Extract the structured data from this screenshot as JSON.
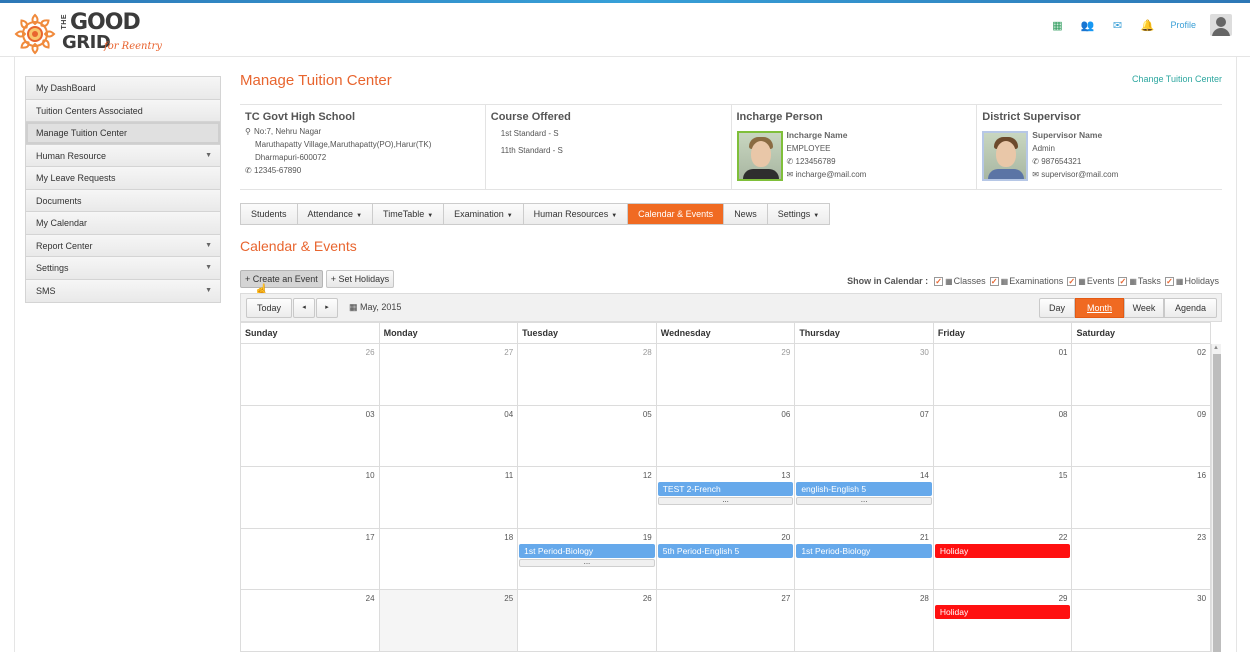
{
  "header": {
    "logo": {
      "the": "THE",
      "good": "GOOD",
      "grid": "GRID",
      "tagline": "for Reentry"
    },
    "icons": [
      "apps-grid-icon",
      "users-icon",
      "mail-icon",
      "bell-icon"
    ],
    "profile_label": "Profile"
  },
  "sidebar": {
    "items": [
      {
        "label": "My DashBoard",
        "has_submenu": false
      },
      {
        "label": "Tuition Centers Associated",
        "has_submenu": false
      },
      {
        "label": "Manage Tuition Center",
        "has_submenu": false,
        "active": true
      },
      {
        "label": "Human Resource",
        "has_submenu": true
      },
      {
        "label": "My Leave Requests",
        "has_submenu": false
      },
      {
        "label": "Documents",
        "has_submenu": false
      },
      {
        "label": "My Calendar",
        "has_submenu": false
      },
      {
        "label": "Report Center",
        "has_submenu": true
      },
      {
        "label": "Settings",
        "has_submenu": true
      },
      {
        "label": "SMS",
        "has_submenu": true
      }
    ]
  },
  "main": {
    "title": "Manage Tuition Center",
    "change_link": "Change Tuition Center",
    "center": {
      "name": "TC Govt High School",
      "address1": "No:7, Nehru Nagar",
      "address2": "Maruthapatty Village,Maruthapatty(PO),Harur(TK)",
      "address3": "Dharmapuri-600072",
      "phone": "12345-67890"
    },
    "course": {
      "title": "Course Offered",
      "items": [
        "1st Standard - S",
        "11th Standard - S"
      ]
    },
    "incharge": {
      "title": "Incharge Person",
      "name_label": "Incharge Name",
      "role": "EMPLOYEE",
      "phone": "123456789",
      "email": "incharge@mail.com"
    },
    "supervisor": {
      "title": "District Supervisor",
      "name_label": "Supervisor Name",
      "role": "Admin",
      "phone": "987654321",
      "email": "supervisor@mail.com"
    },
    "tabs": [
      {
        "label": "Students",
        "dropdown": false
      },
      {
        "label": "Attendance",
        "dropdown": true
      },
      {
        "label": "TimeTable",
        "dropdown": true
      },
      {
        "label": "Examination",
        "dropdown": true
      },
      {
        "label": "Human Resources",
        "dropdown": true
      },
      {
        "label": "Calendar & Events",
        "dropdown": false,
        "active": true
      },
      {
        "label": "News",
        "dropdown": false
      },
      {
        "label": "Settings",
        "dropdown": true
      }
    ],
    "section_title": "Calendar & Events",
    "buttons": {
      "create": "+ Create an Event",
      "holidays": "+ Set Holidays"
    },
    "show_in_calendar": {
      "label": "Show in Calendar :",
      "options": [
        "Classes",
        "Examinations",
        "Events",
        "Tasks",
        "Holidays"
      ]
    }
  },
  "calendar": {
    "today": "Today",
    "prev": "◂",
    "next": "▸",
    "current": "May, 2015",
    "views": [
      "Day",
      "Month",
      "Week",
      "Agenda"
    ],
    "active_view": "Month",
    "weekdays": [
      "Sunday",
      "Monday",
      "Tuesday",
      "Wednesday",
      "Thursday",
      "Friday",
      "Saturday"
    ],
    "weeks": [
      [
        {
          "d": "26",
          "o": true
        },
        {
          "d": "27",
          "o": true
        },
        {
          "d": "28",
          "o": true
        },
        {
          "d": "29",
          "o": true
        },
        {
          "d": "30",
          "o": true
        },
        {
          "d": "01"
        },
        {
          "d": "02"
        }
      ],
      [
        {
          "d": "03"
        },
        {
          "d": "04"
        },
        {
          "d": "05"
        },
        {
          "d": "06"
        },
        {
          "d": "07"
        },
        {
          "d": "08"
        },
        {
          "d": "09"
        }
      ],
      [
        {
          "d": "10"
        },
        {
          "d": "11"
        },
        {
          "d": "12"
        },
        {
          "d": "13",
          "event": "TEST 2-French",
          "more": "..."
        },
        {
          "d": "14",
          "event": "english-English 5",
          "more": "..."
        },
        {
          "d": "15"
        },
        {
          "d": "16"
        }
      ],
      [
        {
          "d": "17"
        },
        {
          "d": "18"
        },
        {
          "d": "19",
          "event": "1st Period-Biology",
          "more": "..."
        },
        {
          "d": "20",
          "event": "5th Period-English 5"
        },
        {
          "d": "21",
          "event": "1st Period-Biology"
        },
        {
          "d": "22",
          "event": "Holiday",
          "holiday": true
        },
        {
          "d": "23"
        }
      ],
      [
        {
          "d": "24"
        },
        {
          "d": "25",
          "shade": true
        },
        {
          "d": "26"
        },
        {
          "d": "27"
        },
        {
          "d": "28"
        },
        {
          "d": "29",
          "event": "Holiday",
          "holiday": true
        },
        {
          "d": "30"
        }
      ]
    ]
  },
  "colors": {
    "accent": "#f06a22",
    "event": "#66a9eb",
    "holiday": "#ff1010",
    "link": "#2ea7a0"
  }
}
